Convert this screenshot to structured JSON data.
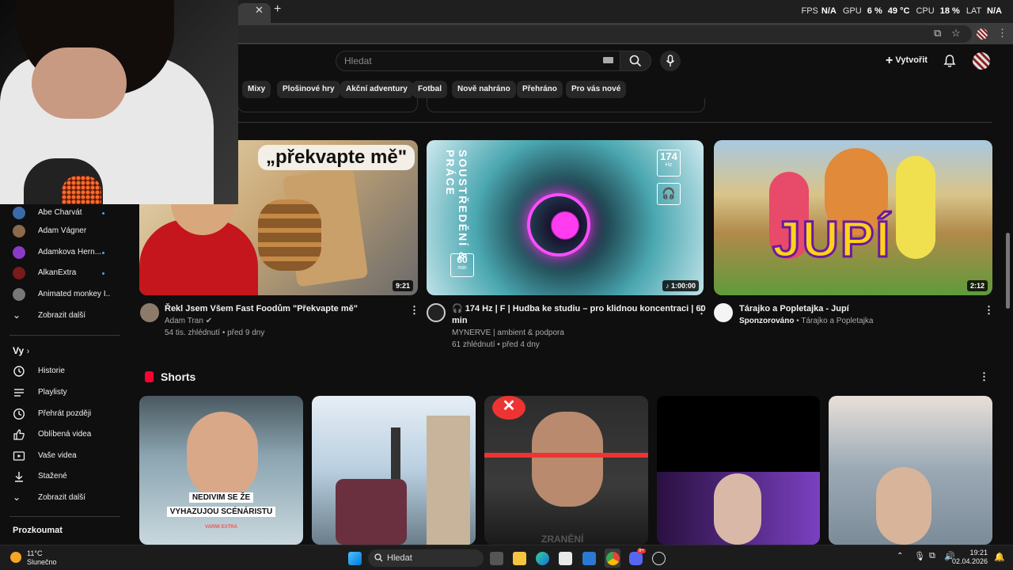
{
  "overlay": {
    "fps_label": "FPS",
    "fps_value": "N/A",
    "gpu_label": "GPU",
    "gpu_value": "6 %",
    "gpu_temp": "49 °C",
    "cpu_label": "CPU",
    "cpu_value": "18 %",
    "lat_label": "LAT",
    "lat_value": "N/A"
  },
  "header": {
    "search_placeholder": "Hledat",
    "create_label": "Vytvořit"
  },
  "chips": [
    "Mixy",
    "Plošinové hry",
    "Akční adventury",
    "Fotbal",
    "Nově nahráno",
    "Přehráno",
    "Pro vás nové"
  ],
  "videos": [
    {
      "title": "Řekl Jsem Všem Fast Foodům \"Překvapte mě\"",
      "channel": "Adam Tran",
      "meta": "54 tis. zhlédnutí • před 9 dny",
      "duration": "9:21",
      "thumb_text": "„překvapte mě\""
    },
    {
      "title_line1": "🎧 174 Hz | F | Hudba ke studiu – pro klidnou koncentraci | 60",
      "title_line2": "min",
      "channel": "MYNERVE | ambient & podpora",
      "meta": "61 zhlédnutí • před 4 dny",
      "duration": "♪ 1:00:00",
      "thumb_side": "SOUSTŘEDĚNÍ & PRÁCE",
      "thumb_hz": "174",
      "thumb_hz_unit": "Hz",
      "thumb_min": "60",
      "thumb_min_unit": "min"
    },
    {
      "title": "Tárajko a Popletajka - Jupí",
      "sponsored": "Sponzorováno",
      "channel": "• Tárajko a Popletajka",
      "duration": "2:12",
      "thumb_text": "JUPÍ"
    }
  ],
  "shorts": {
    "title": "Shorts",
    "first_caption_line1": "NEDIVIM SE ŽE",
    "first_caption_line2": "VYHAZUJOU SCÉNÁRISTU",
    "first_caption_tag": "VARMI EXTRA",
    "third_caption": "ZRANĚNÍ"
  },
  "sidebar": {
    "subscriptions": [
      {
        "name": "Abe Charvát",
        "dot": true
      },
      {
        "name": "Adam Vágner",
        "dot": false
      },
      {
        "name": "Adamkova Hern...",
        "dot": true
      },
      {
        "name": "AlkanExtra",
        "dot": true
      },
      {
        "name": "Animated monkey I...",
        "dot": false
      }
    ],
    "show_more": "Zobrazit další",
    "you_heading": "Vy",
    "you_items": [
      "Historie",
      "Playlisty",
      "Přehrát později",
      "Oblíbená videa",
      "Vaše videa",
      "Stažené",
      "Zobrazit další"
    ],
    "explore_heading": "Prozkoumat"
  },
  "taskbar": {
    "temp": "11°C",
    "weather": "Slunečno",
    "search": "Hledat",
    "time": "19:21",
    "date": "02.04.2026",
    "discord_badge": "9+"
  }
}
